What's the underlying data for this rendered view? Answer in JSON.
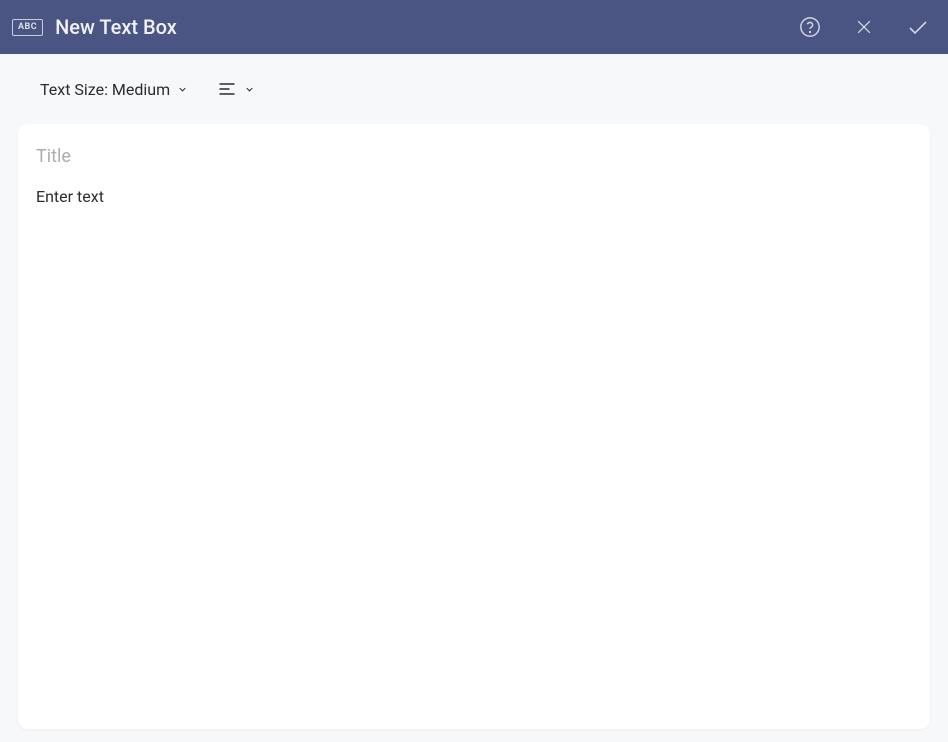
{
  "header": {
    "badge": "ABC",
    "title": "New Text Box"
  },
  "toolbar": {
    "text_size_label": "Text Size: Medium"
  },
  "content": {
    "title_placeholder": "Title",
    "body_placeholder": "Enter text"
  },
  "colors": {
    "header_bg": "#4a5583",
    "body_bg": "#f7f8fa"
  }
}
